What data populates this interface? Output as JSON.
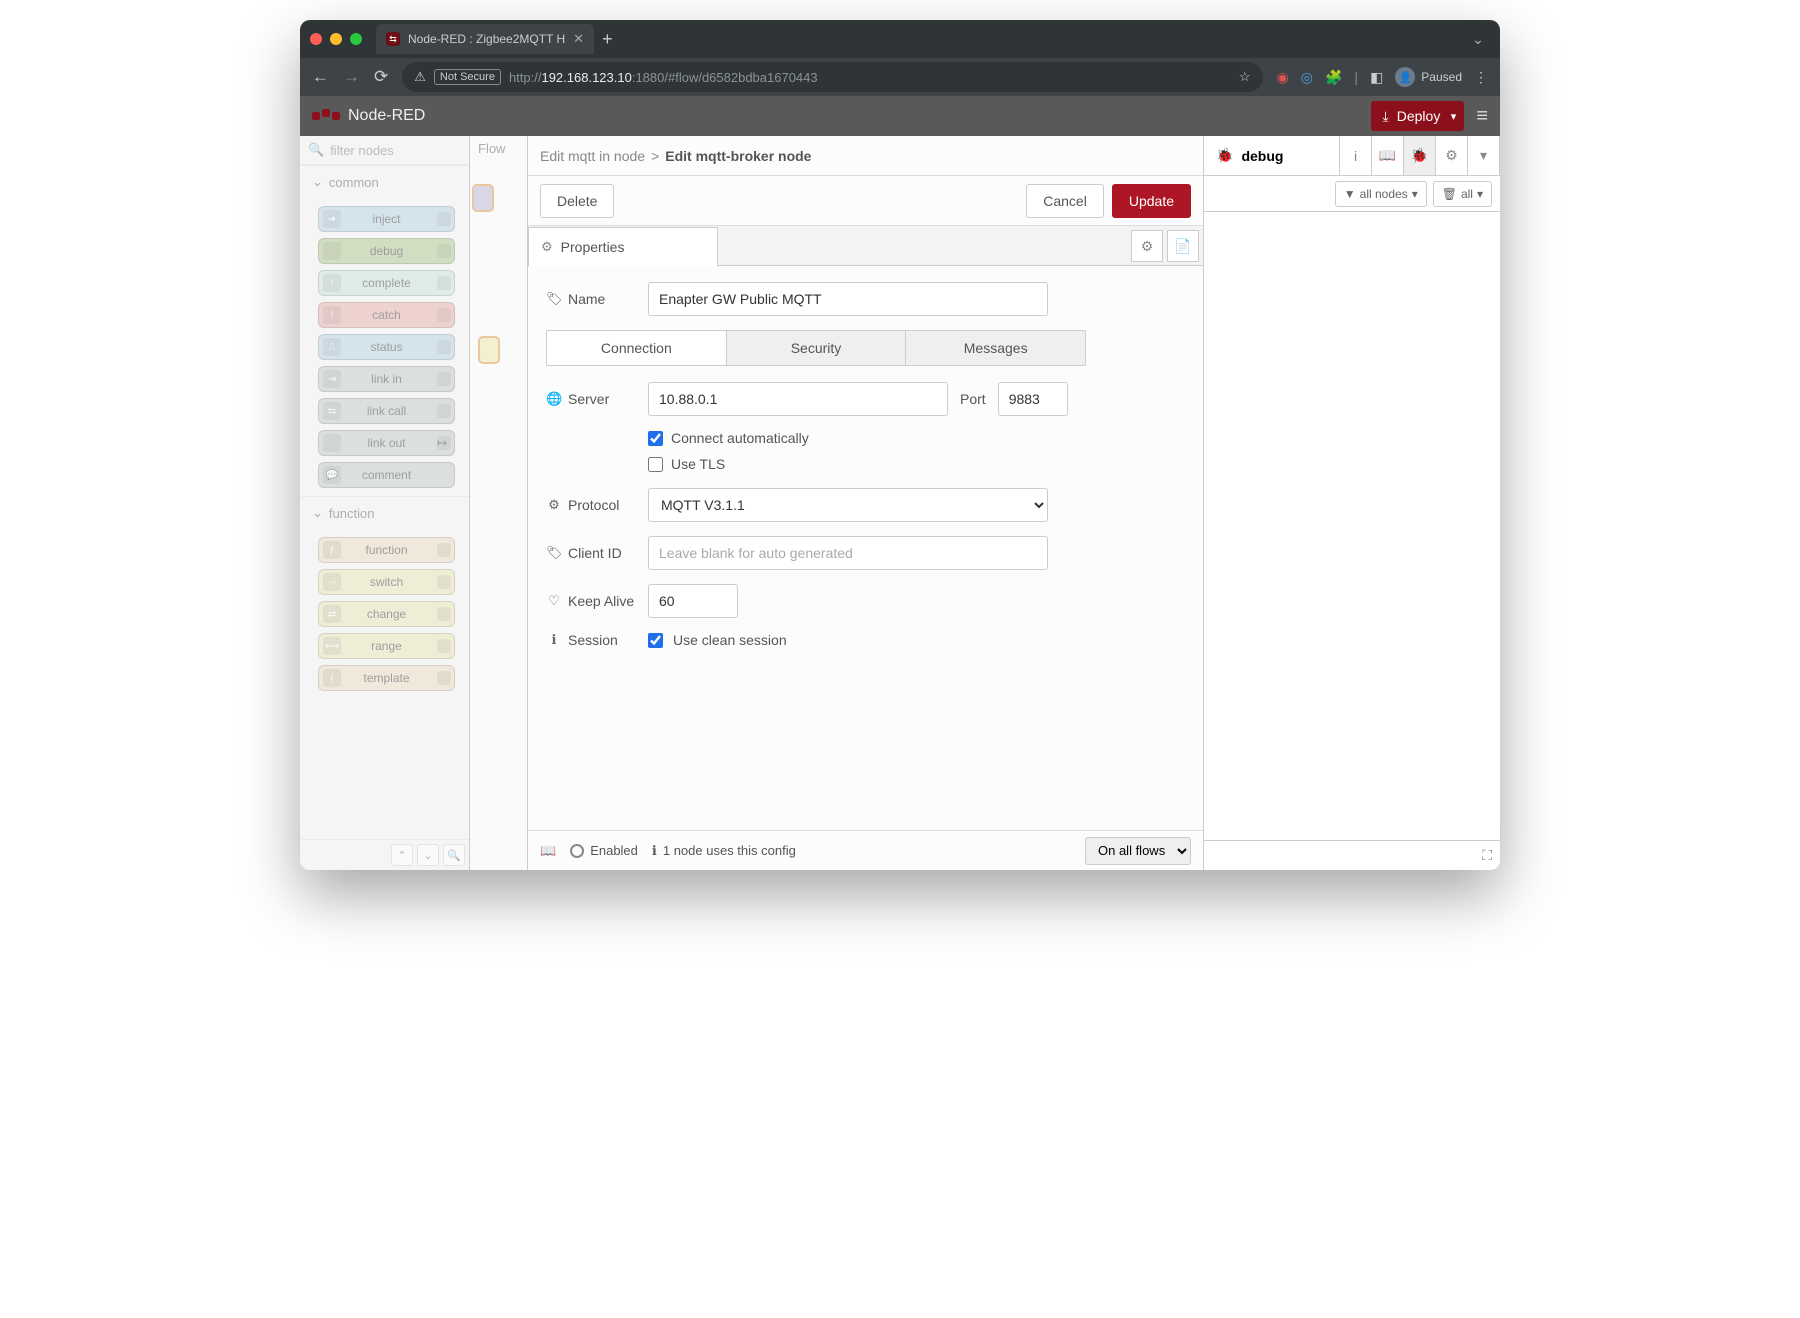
{
  "browser": {
    "tab_title": "Node-RED : Zigbee2MQTT H",
    "not_secure": "Not Secure",
    "url_prefix": "http://",
    "url_host": "192.168.123.10",
    "url_rest": ":1880/#flow/d6582bdba1670443",
    "paused": "Paused"
  },
  "header": {
    "title": "Node-RED",
    "deploy": "Deploy"
  },
  "palette": {
    "filter_placeholder": "filter nodes",
    "cat_common": "common",
    "cat_function": "function",
    "nodes_common": [
      "inject",
      "debug",
      "complete",
      "catch",
      "status",
      "link in",
      "link call",
      "link out",
      "comment"
    ],
    "nodes_function": [
      "function",
      "switch",
      "change",
      "range",
      "template"
    ]
  },
  "workspace": {
    "tab": "Flow"
  },
  "tray": {
    "breadcrumb_prev": "Edit mqtt in node",
    "breadcrumb_cur": "Edit mqtt-broker node",
    "delete": "Delete",
    "cancel": "Cancel",
    "update": "Update",
    "properties": "Properties",
    "tabs": {
      "connection": "Connection",
      "security": "Security",
      "messages": "Messages"
    },
    "labels": {
      "name": "Name",
      "server": "Server",
      "port": "Port",
      "protocol": "Protocol",
      "client_id": "Client ID",
      "keep_alive": "Keep Alive",
      "session": "Session"
    },
    "values": {
      "name": "Enapter GW Public MQTT",
      "server": "10.88.0.1",
      "port": "9883",
      "protocol": "MQTT V3.1.1",
      "client_id_placeholder": "Leave blank for auto generated",
      "keep_alive": "60"
    },
    "checks": {
      "connect_auto": "Connect automatically",
      "use_tls": "Use TLS",
      "clean_session": "Use clean session"
    },
    "footer": {
      "enabled": "Enabled",
      "uses": "1 node uses this config",
      "scope": "On all flows"
    }
  },
  "debug": {
    "title": "debug",
    "all_nodes": "all nodes",
    "all": "all"
  }
}
